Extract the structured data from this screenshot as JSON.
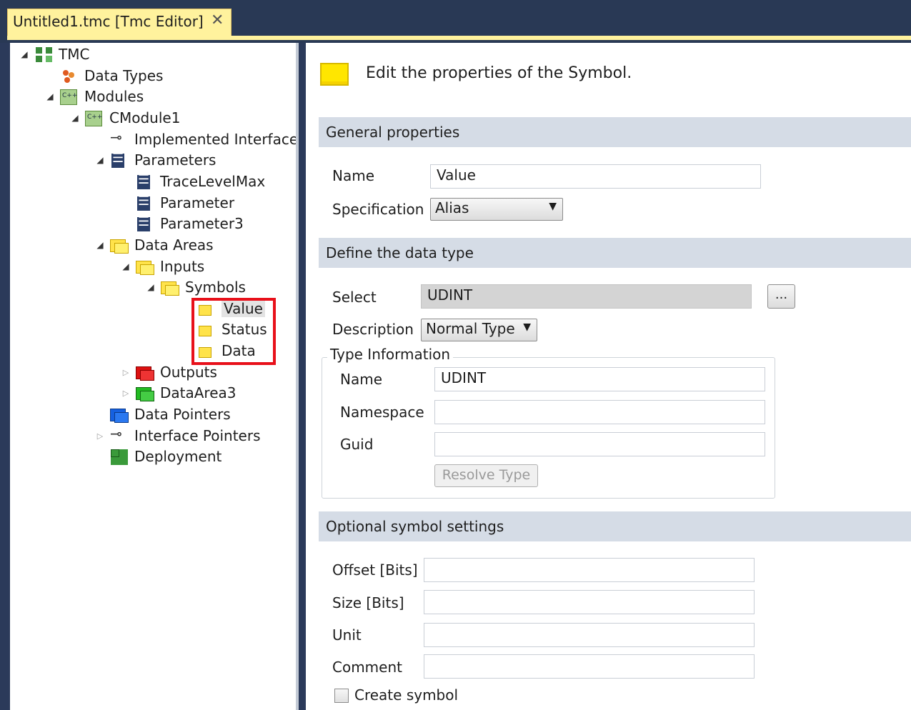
{
  "tab": {
    "title": "Untitled1.tmc [Tmc Editor]",
    "close_glyph": "✕"
  },
  "tree": {
    "items": [
      {
        "label": "TMC",
        "icon": "tmc-icon"
      },
      {
        "label": "Data Types",
        "icon": "data-types-icon"
      },
      {
        "label": "Modules",
        "icon": "modules-icon"
      },
      {
        "label": "CModule1",
        "icon": "cpp-module-icon"
      },
      {
        "label": "Implemented Interfaces",
        "icon": "interface-icon"
      },
      {
        "label": "Parameters",
        "icon": "parameters-icon"
      },
      {
        "label": "TraceLevelMax",
        "icon": "parameter-icon"
      },
      {
        "label": "Parameter",
        "icon": "parameter-icon"
      },
      {
        "label": "Parameter3",
        "icon": "parameter-icon"
      },
      {
        "label": "Data Areas",
        "icon": "folder-yellow-icon"
      },
      {
        "label": "Inputs",
        "icon": "folder-yellow-icon"
      },
      {
        "label": "Symbols",
        "icon": "folder-yellow-icon"
      },
      {
        "label": "Value",
        "icon": "symbol-icon"
      },
      {
        "label": "Status",
        "icon": "symbol-icon"
      },
      {
        "label": "Data",
        "icon": "symbol-icon"
      },
      {
        "label": "Outputs",
        "icon": "folder-red-icon"
      },
      {
        "label": "DataArea3",
        "icon": "folder-green-icon"
      },
      {
        "label": "Data Pointers",
        "icon": "folder-blue-icon"
      },
      {
        "label": "Interface Pointers",
        "icon": "interface-pointer-icon"
      },
      {
        "label": "Deployment",
        "icon": "deployment-icon"
      }
    ],
    "highlight_color": "#e8101a"
  },
  "header": {
    "text": "Edit the properties of the Symbol.",
    "icon": "symbol-icon"
  },
  "general": {
    "title": "General properties",
    "name_label": "Name",
    "name_value": "Value",
    "spec_label": "Specification",
    "spec_value": "Alias"
  },
  "datatype": {
    "title": "Define the data type",
    "select_label": "Select",
    "select_value": "UDINT",
    "browse_label": "...",
    "desc_label": "Description",
    "desc_value": "Normal Type",
    "typeinfo": {
      "legend": "Type Information",
      "name_label": "Name",
      "name_value": "UDINT",
      "namespace_label": "Namespace",
      "namespace_value": "",
      "guid_label": "Guid",
      "guid_value": "",
      "resolve_label": "Resolve Type"
    }
  },
  "optional": {
    "title": "Optional symbol settings",
    "offset_label": "Offset [Bits]",
    "offset_value": "",
    "size_label": "Size [Bits]",
    "size_value": "",
    "unit_label": "Unit",
    "unit_value": "",
    "comment_label": "Comment",
    "comment_value": "",
    "create_label": "Create symbol"
  },
  "colors": {
    "tab_active": "#fff29d",
    "section_bar": "#d5dce6",
    "chrome": "#293955"
  }
}
